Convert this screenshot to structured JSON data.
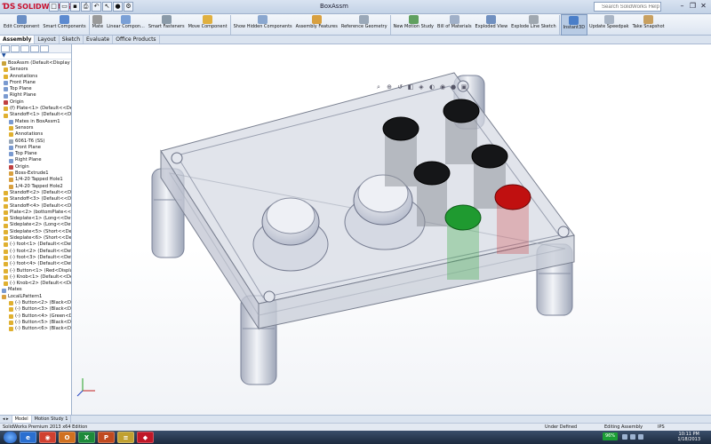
{
  "app": {
    "brand": "SOLIDWORKS",
    "window_title": "BoxAssm",
    "help_placeholder": "Search SolidWorks Help"
  },
  "ribbon": [
    {
      "label": "Edit Component",
      "color": "#6b8fc5"
    },
    {
      "label": "Smart Components",
      "color": "#5c8ad0"
    },
    {
      "label": "Mate",
      "color": "#9a9a9a"
    },
    {
      "label": "Linear Compon...",
      "color": "#7aa0d6"
    },
    {
      "label": "Smart Fasteners",
      "color": "#8a9aa8"
    },
    {
      "label": "Move Component",
      "color": "#e0b040"
    },
    {
      "label": "Show Hidden Components",
      "color": "#8aa7cf"
    },
    {
      "label": "Assembly Features",
      "color": "#d8a040"
    },
    {
      "label": "Reference Geometry",
      "color": "#9aa8b8"
    },
    {
      "label": "New Motion Study",
      "color": "#60a060"
    },
    {
      "label": "Bill of Materials",
      "color": "#a0b0c8"
    },
    {
      "label": "Exploded View",
      "color": "#7090c0"
    },
    {
      "label": "Explode Line Sketch",
      "color": "#a0a8b0"
    },
    {
      "label": "Instant3D",
      "color": "#4a7ec8",
      "active": true
    },
    {
      "label": "Update Speedpak",
      "color": "#a8b4c4"
    },
    {
      "label": "Take Snapshot",
      "color": "#c8a060"
    }
  ],
  "tabs": [
    {
      "label": "Assembly",
      "active": true
    },
    {
      "label": "Layout"
    },
    {
      "label": "Sketch"
    },
    {
      "label": "Evaluate"
    },
    {
      "label": "Office Products"
    }
  ],
  "tree": [
    {
      "label": "BoxAssm (Default<Display State",
      "level": 0,
      "color": "#c9a23a"
    },
    {
      "label": "Sensors",
      "level": 1,
      "color": "#e0b030"
    },
    {
      "label": "Annotations",
      "level": 1,
      "color": "#e0b030"
    },
    {
      "label": "Front Plane",
      "level": 1,
      "color": "#7a9ad0"
    },
    {
      "label": "Top Plane",
      "level": 1,
      "color": "#7a9ad0"
    },
    {
      "label": "Right Plane",
      "level": 1,
      "color": "#7a9ad0"
    },
    {
      "label": "Origin",
      "level": 1,
      "color": "#c04040"
    },
    {
      "label": "(f) Plate<1> (Default<<Default",
      "level": 1,
      "color": "#e0b030"
    },
    {
      "label": "Standoff<1> (Default<<Default",
      "level": 1,
      "color": "#e0b030"
    },
    {
      "label": "Mates in BoxAssm1",
      "level": 2,
      "color": "#7a9ad0"
    },
    {
      "label": "Sensors",
      "level": 2,
      "color": "#e0b030"
    },
    {
      "label": "Annotations",
      "level": 2,
      "color": "#e0b030"
    },
    {
      "label": "6061-T6 (SS)",
      "level": 2,
      "color": "#9aa8b8"
    },
    {
      "label": "Front Plane",
      "level": 2,
      "color": "#7a9ad0"
    },
    {
      "label": "Top Plane",
      "level": 2,
      "color": "#7a9ad0"
    },
    {
      "label": "Right Plane",
      "level": 2,
      "color": "#7a9ad0"
    },
    {
      "label": "Origin",
      "level": 2,
      "color": "#c04040"
    },
    {
      "label": "Boss-Extrude1",
      "level": 2,
      "color": "#d8a040"
    },
    {
      "label": "1/4-20 Tapped Hole1",
      "level": 2,
      "color": "#d8a040"
    },
    {
      "label": "1/4-20 Tapped Hole2",
      "level": 2,
      "color": "#d8a040"
    },
    {
      "label": "Standoff<2> (Default<<Defaul",
      "level": 1,
      "color": "#e0b030"
    },
    {
      "label": "Standoff<3> (Default<<Defaul",
      "level": 1,
      "color": "#e0b030"
    },
    {
      "label": "Standoff<4> (Default<<Defaul",
      "level": 1,
      "color": "#e0b030"
    },
    {
      "label": "Plate<2> (bottomPlate<<Defa",
      "level": 1,
      "color": "#e0b030"
    },
    {
      "label": "Sideplate<1> (Long<<Default",
      "level": 1,
      "color": "#e0b030"
    },
    {
      "label": "Sideplate<2> (Long<<Default",
      "level": 1,
      "color": "#e0b030"
    },
    {
      "label": "Sideplate<5> (Short<<Defaul",
      "level": 1,
      "color": "#e0b030"
    },
    {
      "label": "Sideplate<6> (Short<<Defaul",
      "level": 1,
      "color": "#e0b030"
    },
    {
      "label": "(-) foot<1> (Default<<Default",
      "level": 1,
      "color": "#e0b030"
    },
    {
      "label": "(-) foot<2> (Default<<Default",
      "level": 1,
      "color": "#e0b030"
    },
    {
      "label": "(-) foot<3> (Default<<Default",
      "level": 1,
      "color": "#e0b030"
    },
    {
      "label": "(-) foot<4> (Default<<Default",
      "level": 1,
      "color": "#e0b030"
    },
    {
      "label": "(-) Button<1> (Red<Display St",
      "level": 1,
      "color": "#e0b030"
    },
    {
      "label": "(-) Knob<1> (Default<<Default",
      "level": 1,
      "color": "#e0b030"
    },
    {
      "label": "(-) Knob<2> (Default<<Default",
      "level": 1,
      "color": "#e0b030"
    },
    {
      "label": "Mates",
      "level": 0,
      "color": "#7a9ad0"
    },
    {
      "label": "LocalLPattern1",
      "level": 0,
      "color": "#d8a040"
    },
    {
      "label": "(-) Button<2> (Black<Disp",
      "level": 2,
      "color": "#e0b030"
    },
    {
      "label": "(-) Button<3> (Black<Disp",
      "level": 2,
      "color": "#e0b030"
    },
    {
      "label": "(-) Button<4> (Green<Disp",
      "level": 2,
      "color": "#e0b030"
    },
    {
      "label": "(-) Button<5> (Black<Disp",
      "level": 2,
      "color": "#e0b030"
    },
    {
      "label": "(-) Button<6> (Black<Disp",
      "level": 2,
      "color": "#e0b030"
    }
  ],
  "bottom_tabs": [
    {
      "label": "Model",
      "active": true
    },
    {
      "label": "Motion Study 1"
    }
  ],
  "status": {
    "edition": "SolidWorks Premium 2013 x64 Edition",
    "state": "Under Defined",
    "mode": "Editing Assembly",
    "units": "IPS"
  },
  "taskbar": {
    "items": [
      {
        "label": "e",
        "color": "#2a6fd0"
      },
      {
        "label": "◉",
        "color": "#d04030"
      },
      {
        "label": "O",
        "color": "#d07020"
      },
      {
        "label": "X",
        "color": "#1e8a3a"
      },
      {
        "label": "P",
        "color": "#c04a20"
      },
      {
        "label": "≡",
        "color": "#c0a030"
      },
      {
        "label": "◆",
        "color": "#c01828"
      }
    ],
    "battery": "96%",
    "time": "10:11 PM",
    "date": "1/18/2013"
  }
}
